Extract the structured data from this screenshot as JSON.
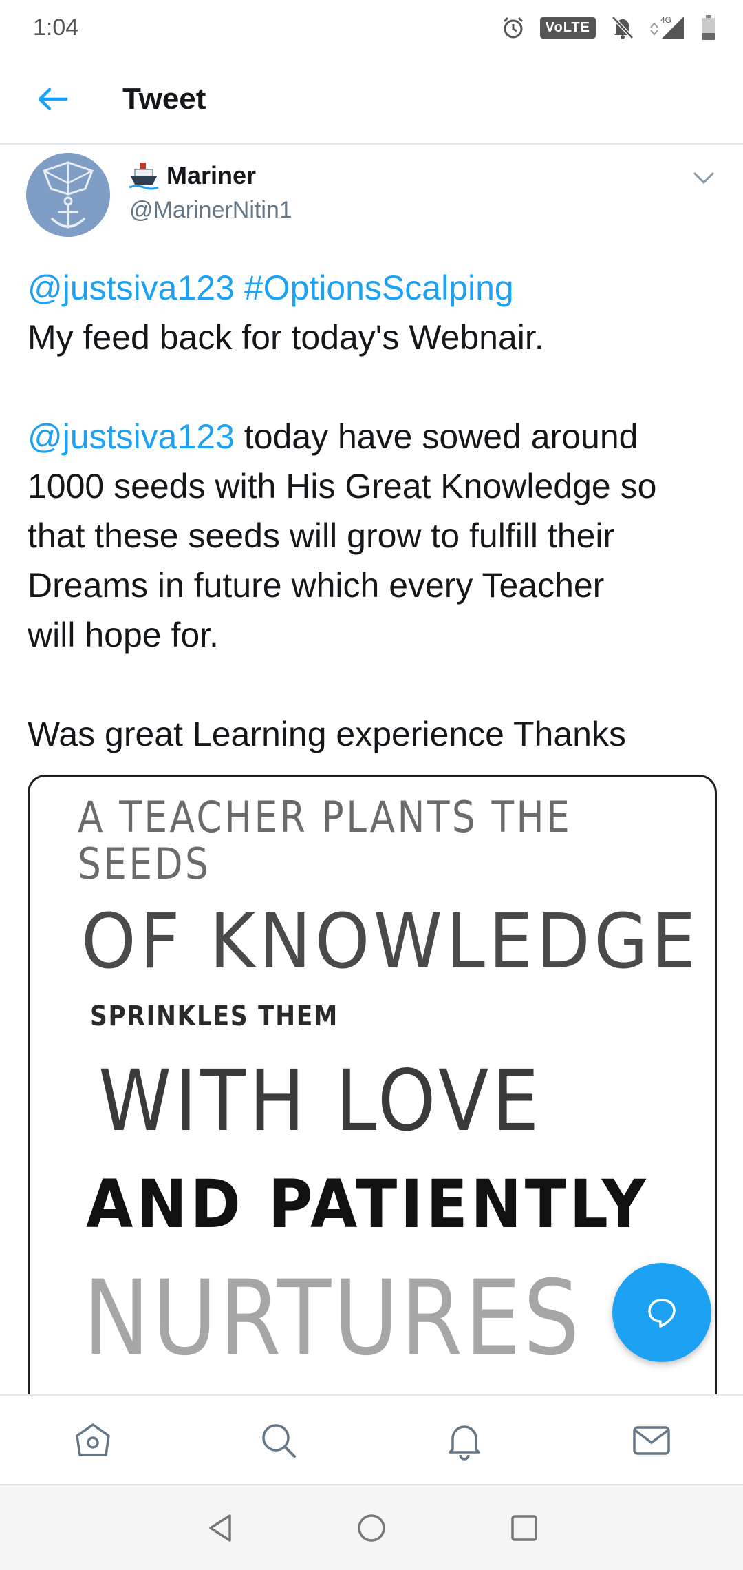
{
  "status_bar": {
    "time": "1:04",
    "volte": "VoLTE",
    "network": "4G"
  },
  "header": {
    "title": "Tweet",
    "back_icon": "arrow-left-icon"
  },
  "tweet": {
    "author_name": "Mariner",
    "author_emoji": "ship-icon",
    "author_handle": "@MarinerNitin1",
    "paragraphs": {
      "p1_mention": "@justsiva123",
      "p1_hashtag": "#OptionsScalping",
      "p1_text": "My feed back for today's Webnair.",
      "p2_mention": "@justsiva123",
      "p2_line1": " today have sowed around",
      "p2_line2": "1000 seeds with His Great Knowledge so",
      "p2_line3": "that these seeds will grow to fulfill their",
      "p2_line4": "Dreams in future which every Teacher",
      "p2_line5": "will hope for.",
      "p3_text": "Was great Learning experience Thanks"
    },
    "image_text": {
      "line1": "A TEACHER PLANTS THE",
      "line2": "SEEDS",
      "line3": "OF KNOWLEDGE",
      "line4": "SPRINKLES THEM",
      "line5": "WITH LOVE",
      "line6": "AND PATIENTLY",
      "line7": "NURTURES"
    }
  },
  "colors": {
    "accent": "#1da1f2",
    "text": "#14171a",
    "secondary": "#657786",
    "divider": "#e1e8ed"
  },
  "bottom_nav": [
    "home-icon",
    "search-icon",
    "notifications-icon",
    "messages-icon"
  ],
  "system_nav": [
    "back-triangle-icon",
    "home-circle-icon",
    "recents-square-icon"
  ]
}
